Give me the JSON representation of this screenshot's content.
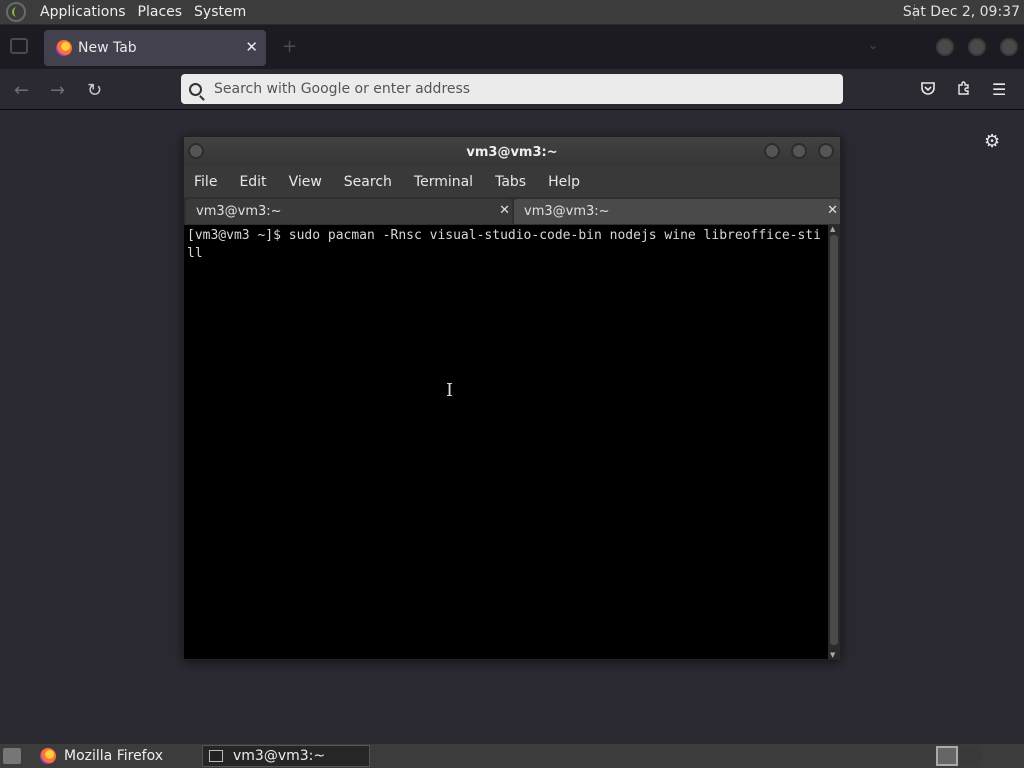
{
  "top_panel": {
    "menus": [
      "Applications",
      "Places",
      "System"
    ],
    "clock": "Sat Dec 2, 09:37"
  },
  "firefox": {
    "tab": {
      "title": "New Tab"
    },
    "url_placeholder": "Search with Google or enter address",
    "icons": {
      "back": "arrow-left-icon",
      "forward": "arrow-right-icon",
      "reload": "reload-icon",
      "pocket": "pocket-icon",
      "extensions": "puzzle-icon",
      "menu": "hamburger-icon",
      "settings": "gear-icon"
    }
  },
  "terminal": {
    "title": "vm3@vm3:~",
    "menu": [
      "File",
      "Edit",
      "View",
      "Search",
      "Terminal",
      "Tabs",
      "Help"
    ],
    "tabs": [
      {
        "label": "vm3@vm3:~"
      },
      {
        "label": "vm3@vm3:~"
      }
    ],
    "content": "[vm3@vm3 ~]$ sudo pacman -Rnsc visual-studio-code-bin nodejs wine libreoffice-still"
  },
  "taskbar": {
    "tasks": [
      {
        "label": "Mozilla Firefox"
      },
      {
        "label": "vm3@vm3:~"
      }
    ]
  },
  "colors": {
    "panel": "#3c3c3c",
    "firefox_bg": "#2b2a33",
    "terminal_bg": "#000000",
    "url_bar": "#ebebeb"
  }
}
